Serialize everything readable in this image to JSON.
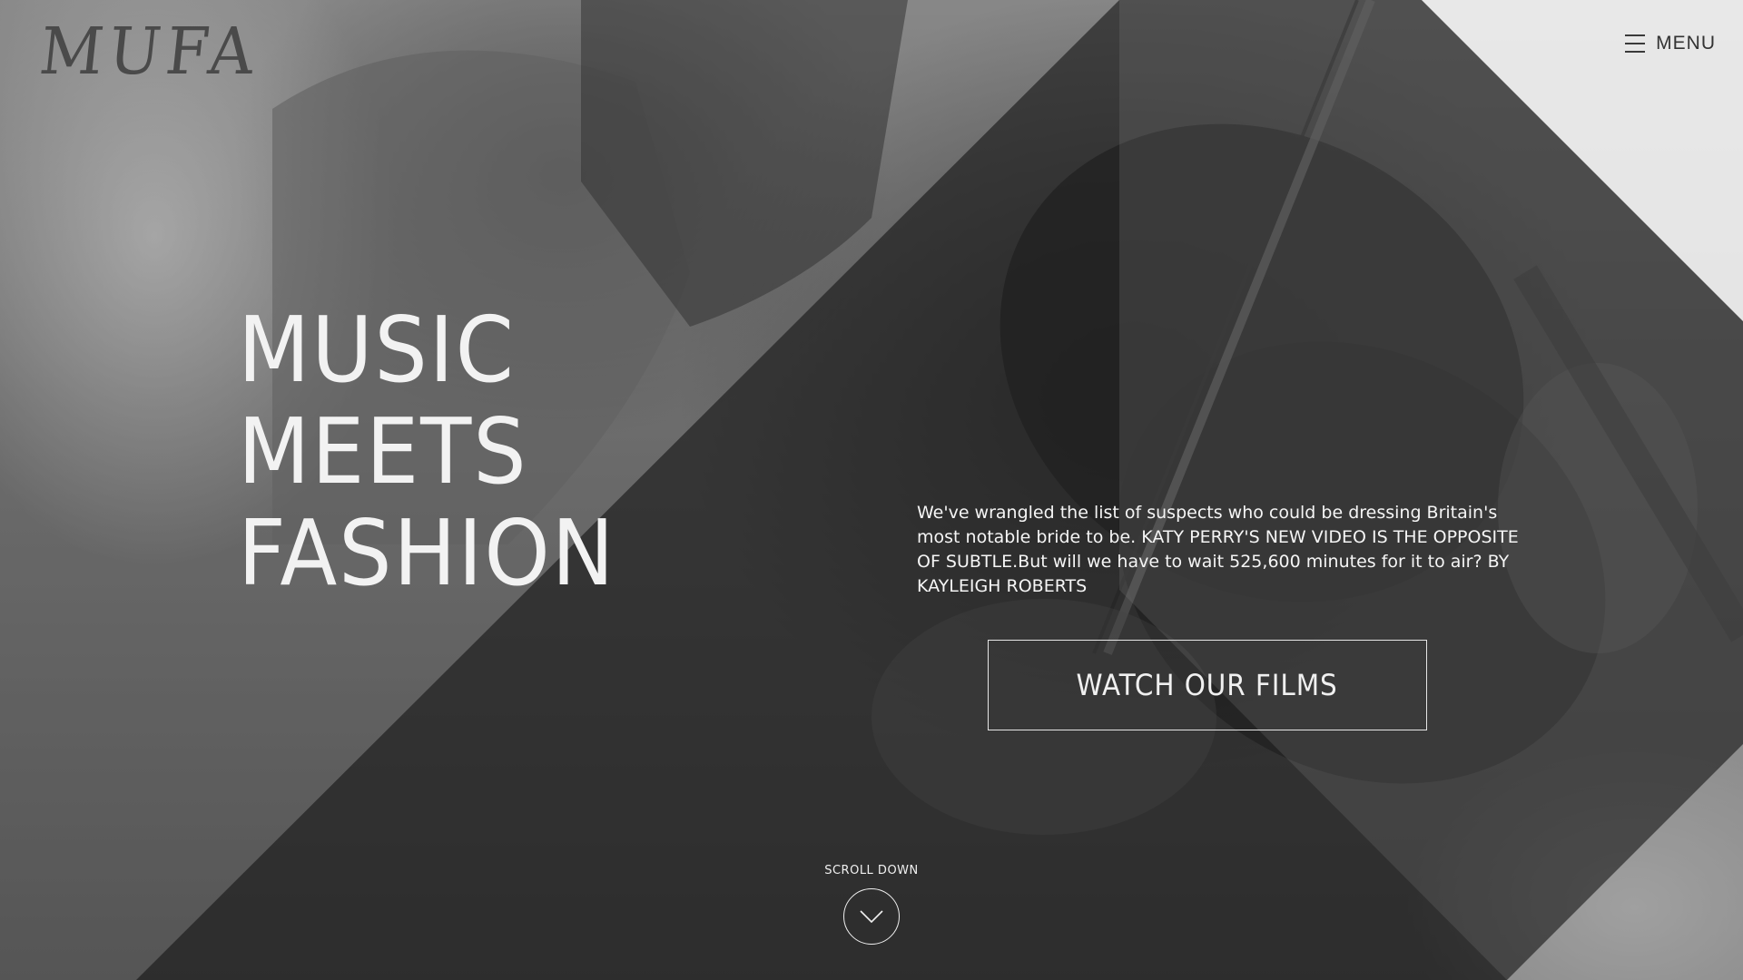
{
  "brand": {
    "logo_text": "MUFA"
  },
  "header": {
    "menu_label": "MENU",
    "menu_icon": "hamburger-icon"
  },
  "hero": {
    "headline_lines": [
      "MUSIC",
      "MEETS",
      "FASHION"
    ],
    "blurb": "We've wrangled the list of suspects who could be dressing Britain's most notable bride to be. KATY PERRY'S NEW VIDEO IS THE OPPOSITE OF SUBTLE.But will we have to wait 525,600 minutes for it to air? BY KAYLEIGH ROBERTS",
    "cta_label": "WATCH OUR FILMS"
  },
  "scroll": {
    "label": "SCROLL DOWN",
    "icon": "chevron-down-icon"
  },
  "colors": {
    "overlay_dark": "#262626",
    "overlay_light": "#7a7a7a",
    "text": "#ffffff"
  }
}
